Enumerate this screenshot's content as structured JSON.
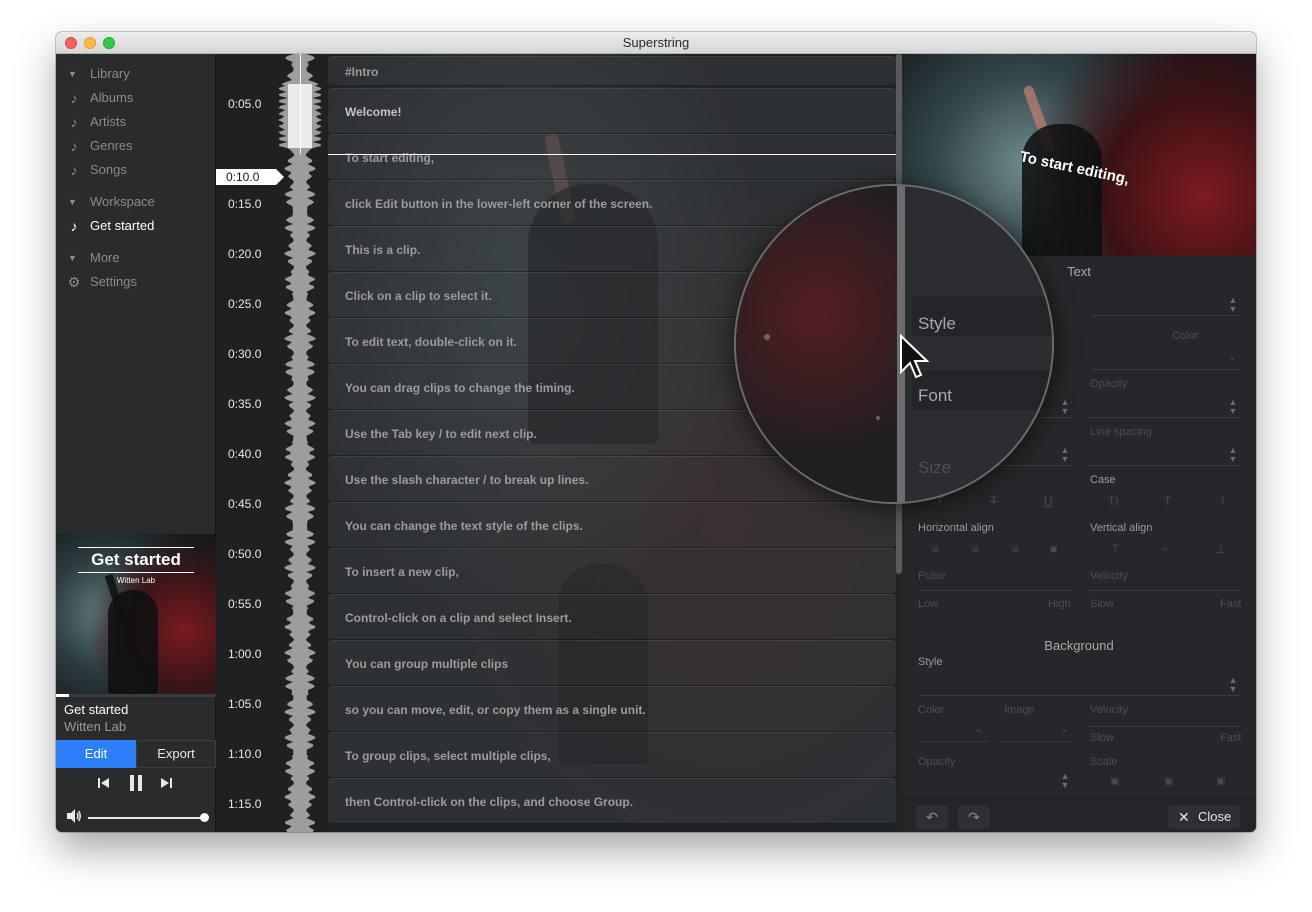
{
  "window": {
    "title": "Superstring"
  },
  "sidebar": {
    "sections": [
      {
        "label": "Library",
        "items": [
          {
            "label": "Albums",
            "icon": "music-note-icon"
          },
          {
            "label": "Artists",
            "icon": "music-note-icon"
          },
          {
            "label": "Genres",
            "icon": "music-note-icon"
          },
          {
            "label": "Songs",
            "icon": "music-note-icon"
          }
        ]
      },
      {
        "label": "Workspace",
        "items": [
          {
            "label": "Get started",
            "icon": "music-note-icon",
            "active": true
          }
        ]
      },
      {
        "label": "More",
        "items": [
          {
            "label": "Settings",
            "icon": "gear-icon"
          }
        ]
      }
    ],
    "now_playing": {
      "cover_title": "Get started",
      "cover_subtitle": "Witten Lab",
      "title": "Get started",
      "artist": "Witten Lab",
      "progress": 0.08,
      "volume": 1.0
    },
    "edit_label": "Edit",
    "export_label": "Export"
  },
  "timeline": {
    "current": "0:10.0",
    "ticks": [
      "0:05.0",
      "0:15.0",
      "0:20.0",
      "0:25.0",
      "0:30.0",
      "0:35.0",
      "0:40.0",
      "0:45.0",
      "0:50.0",
      "0:55.0",
      "1:00.0",
      "1:05.0",
      "1:10.0",
      "1:15.0"
    ]
  },
  "clips": [
    "#Intro",
    "Welcome!",
    "To start editing,",
    "click Edit button in the lower-left corner of the screen.",
    "This is a clip.",
    "Click on a clip to select it.",
    "To edit text, double-click on it.",
    "You can drag clips to change the timing.",
    "Use the Tab key / to edit next clip.",
    "Use the slash character / to break up lines.",
    "You can change the text style of the clips.",
    "To insert a new clip,",
    "Control-click on a clip and select Insert.",
    "You can group multiple clips",
    "so you can move, edit, or copy them as a single unit.",
    "To group clips, select multiple clips,",
    "then Control-click on the clips, and choose Group."
  ],
  "preview": {
    "text": "To start editing,"
  },
  "text_panel": {
    "title": "Text",
    "style_label": "Style",
    "font_label": "Font",
    "size_label": "Size",
    "color_label": "Color",
    "opacity_label": "Opacity",
    "line_spacing_label": "Line spacing",
    "case_label": "Case",
    "horizontal_align_label": "Horizontal align",
    "vertical_align_label": "Vertical align",
    "pulse_label": "Pulse",
    "velocity_label": "Velocity",
    "low_label": "Low",
    "high_label": "High",
    "slow_label": "Slow",
    "fast_label": "Fast"
  },
  "background_panel": {
    "title": "Background",
    "style_label": "Style",
    "color_label": "Color",
    "image_label": "Image",
    "velocity_label": "Velocity",
    "slow_label": "Slow",
    "fast_label": "Fast",
    "opacity_label": "Opacity",
    "scale_label": "Scale"
  },
  "footer": {
    "close_label": "Close"
  },
  "colors": {
    "accent": "#2d7ff9",
    "background": "#222325"
  }
}
